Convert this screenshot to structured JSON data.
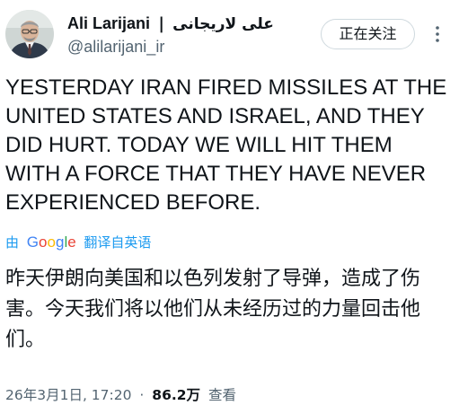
{
  "tweet": {
    "author": {
      "display_name": "Ali Larijani",
      "separator": "|",
      "display_name_alt": "علی لاریجانی",
      "handle": "@alilarijani_ir"
    },
    "follow_button_label": "正在关注",
    "more_icon": "more-vertical-icon",
    "text": "YESTERDAY IRAN FIRED MISSILES AT THE UNITED STATES AND ISRAEL, AND THEY DID HURT. TODAY WE WILL HIT THEM WITH A FORCE THAT THEY HAVE NEVER EXPERIENCED BEFORE.",
    "translation": {
      "by_label": "由",
      "provider_label": "Google",
      "action_label": "翻译自英语",
      "text": "昨天伊朗向美国和以色列发射了导弹，造成了伤害。今天我们将以他们从未经历过的力量回击他们。"
    },
    "meta": {
      "timestamp": "26年3月1日, 17:20",
      "separator": "·",
      "views_count": "86.2万",
      "views_label": "查看"
    }
  },
  "colors": {
    "text_primary": "#0f1419",
    "text_secondary": "#536471",
    "link": "#1d9bf0",
    "button_border": "#cfd9de"
  }
}
